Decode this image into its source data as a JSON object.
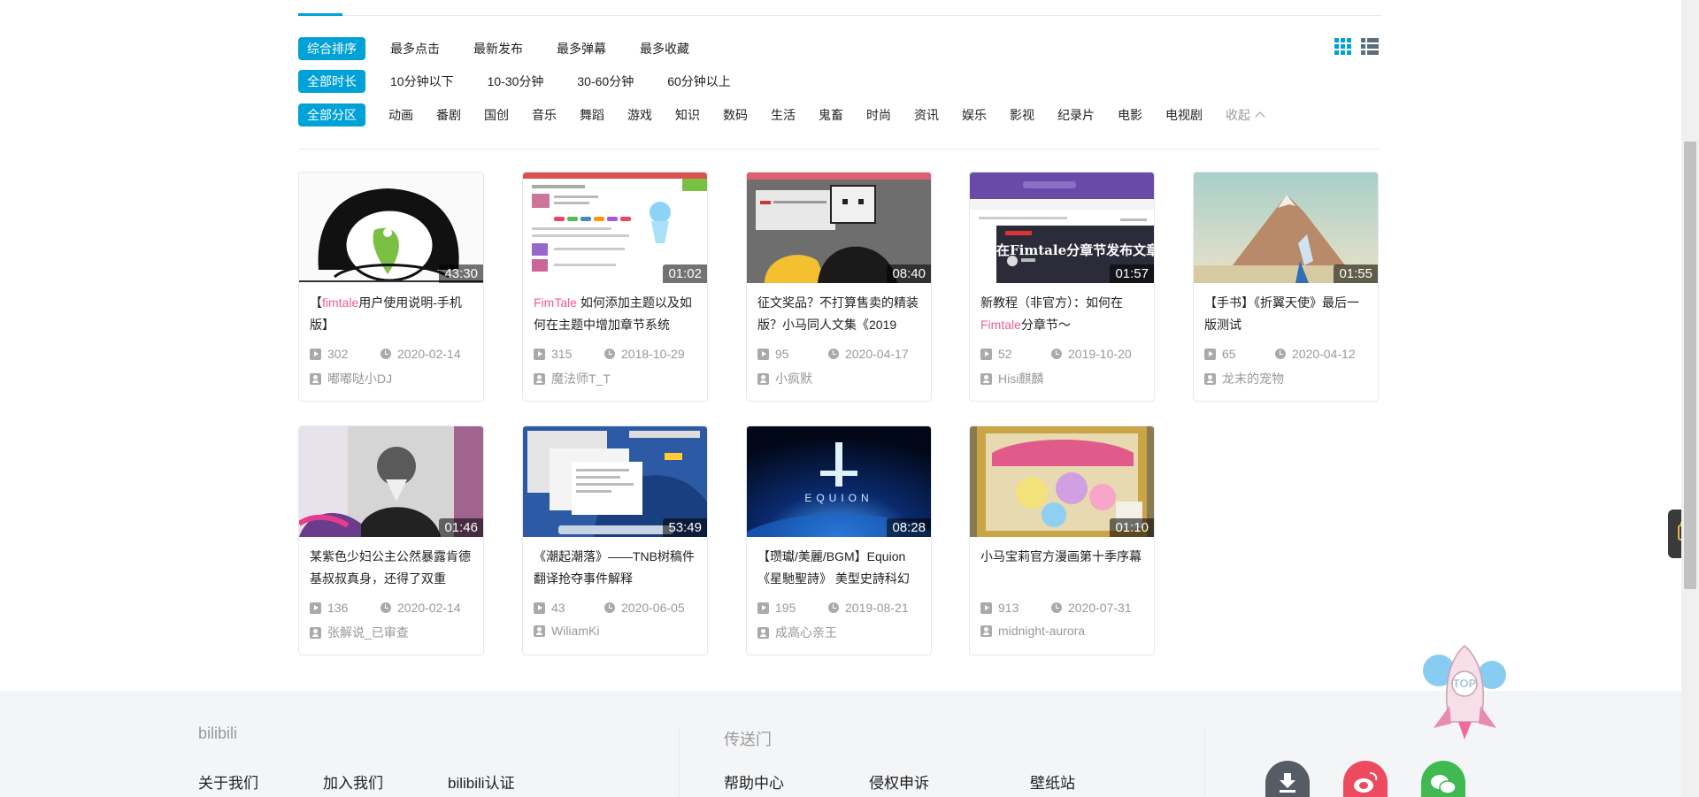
{
  "sort": {
    "items": [
      "综合排序",
      "最多点击",
      "最新发布",
      "最多弹幕",
      "最多收藏"
    ],
    "active": 0
  },
  "duration": {
    "items": [
      "全部时长",
      "10分钟以下",
      "10-30分钟",
      "30-60分钟",
      "60分钟以上"
    ],
    "active": 0
  },
  "zones": {
    "items": [
      "全部分区",
      "动画",
      "番剧",
      "国创",
      "音乐",
      "舞蹈",
      "游戏",
      "知识",
      "数码",
      "生活",
      "鬼畜",
      "时尚",
      "资讯",
      "娱乐",
      "影视",
      "纪录片",
      "电影",
      "电视剧"
    ],
    "active": 0,
    "collapse_label": "收起"
  },
  "videos": [
    {
      "title_hl": "fimtale",
      "title_pre": "【",
      "title_post": "用户使用说明-手机版】",
      "duration": "43:30",
      "plays": "302",
      "date": "2020-02-14",
      "uploader": "嘟嘟哒小DJ"
    },
    {
      "title_hl": "FimTale",
      "title_pre": "",
      "title_post": " 如何添加主题以及如何在主题中增加章节系统",
      "duration": "01:02",
      "plays": "315",
      "date": "2018-10-29",
      "uploader": "魔法师T_T"
    },
    {
      "title_hl": "",
      "title_pre": "征文奖品？不打算售卖的精装版？小马同人文集《2019",
      "title_post": "",
      "duration": "08:40",
      "plays": "95",
      "date": "2020-04-17",
      "uploader": "小疯默"
    },
    {
      "title_hl": "Fimtale",
      "title_pre": "新教程（非官方）：如何在",
      "title_post": "分章节～",
      "duration": "01:57",
      "plays": "52",
      "date": "2019-10-20",
      "uploader": "Hisi麒麟"
    },
    {
      "title_hl": "",
      "title_pre": "【手书】《折翼天使》最后一版测试",
      "title_post": "",
      "duration": "01:55",
      "plays": "65",
      "date": "2020-04-12",
      "uploader": "龙末的宠物"
    },
    {
      "title_hl": "",
      "title_pre": "某紫色少妇公主公然暴露肯德基叔叔真身，还得了双重",
      "title_post": "",
      "duration": "01:46",
      "plays": "136",
      "date": "2020-02-14",
      "uploader": "张解说_已审查"
    },
    {
      "title_hl": "",
      "title_pre": "《潮起潮落》——TNB树稿件翻译抢夺事件解释",
      "title_post": "",
      "duration": "53:49",
      "plays": "43",
      "date": "2020-06-05",
      "uploader": "WiliamKi"
    },
    {
      "title_hl": "",
      "title_pre": "【瓒瓛/美麗/BGM】Equion《星馳聖詩》 美型史詩科幻",
      "title_post": "",
      "duration": "08:28",
      "plays": "195",
      "date": "2019-08-21",
      "uploader": "成高心亲王"
    },
    {
      "title_hl": "",
      "title_pre": "小马宝莉官方漫画第十季序幕",
      "title_post": "",
      "duration": "01:10",
      "plays": "913",
      "date": "2020-07-31",
      "uploader": "midnight-aurora"
    }
  ],
  "thumb_text": {
    "fimtale_banner": "在Fimtale分章节发布文章~",
    "equion": "EQUION",
    "rocket_top": "TOP"
  },
  "footer": {
    "brand": "bilibili",
    "links_left": [
      "关于我们",
      "加入我们",
      "bilibili认证"
    ],
    "portal_title": "传送门",
    "links_mid": [
      "帮助中心",
      "侵权申诉",
      "壁纸站"
    ]
  },
  "colors": {
    "accent": "#00a1d6",
    "highlight": "#f25d8e",
    "muted": "#999999"
  }
}
